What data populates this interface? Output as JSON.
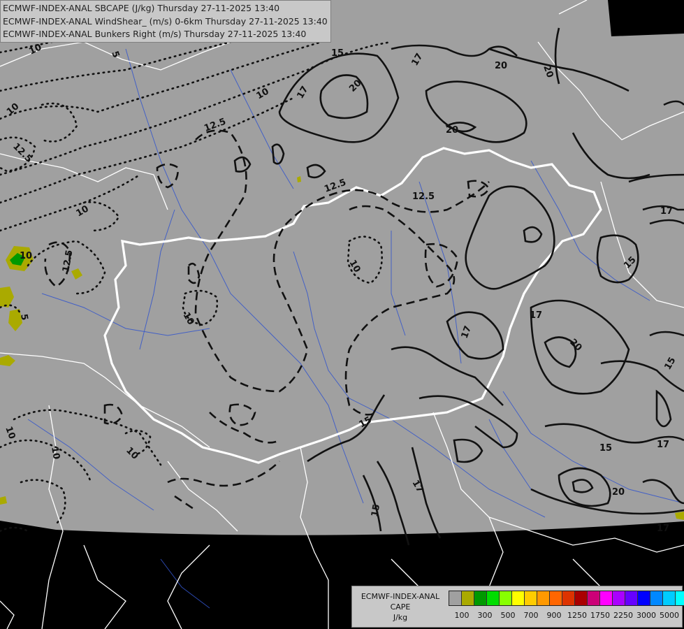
{
  "titles": {
    "line1": "ECMWF-INDEX-ANAL SBCAPE (J/kg) Thursday 27-11-2025 13:40",
    "line2": "ECMWF-INDEX-ANAL WindShear_ (m/s) 0-6km Thursday 27-11-2025 13:40",
    "line3": "ECMWF-INDEX-ANAL Bunkers Right (m/s) Thursday 27-11-2025 13:40"
  },
  "legend": {
    "title_line1": "ECMWF-INDEX-ANAL",
    "title_line2": "CAPE",
    "title_line3": "J/kg",
    "swatch_colors": [
      "#a0a0a0",
      "#aaaa00",
      "#009900",
      "#00dd00",
      "#88ff00",
      "#ffff00",
      "#ffcc00",
      "#ff9900",
      "#ff6600",
      "#dd3300",
      "#aa0000",
      "#cc0077",
      "#ff00ff",
      "#aa00ff",
      "#6600ff",
      "#0000ff",
      "#0088ff",
      "#00ccff",
      "#00ffff",
      "#ffffff"
    ],
    "ticks": [
      "100",
      "300",
      "500",
      "700",
      "900",
      "1250",
      "1750",
      "2250",
      "3000",
      "5000"
    ]
  },
  "contour_labels": {
    "shear_solid": [
      "15",
      "17",
      "20",
      "20",
      "20",
      "17",
      "17",
      "15",
      "17",
      "20",
      "15",
      "17",
      "15",
      "17",
      "20",
      "15",
      "17",
      "15",
      "17",
      "20",
      "15",
      "17"
    ],
    "shear_dashed": [
      "12.5",
      "12.5",
      "12.5",
      "10",
      "10",
      "10"
    ],
    "bunkers_dotted": [
      "10",
      "5",
      "10",
      "12.5",
      "12.5",
      "10",
      "10",
      "5",
      "10",
      "10",
      "10"
    ]
  },
  "colors": {
    "map_fill": "#a0a0a0",
    "outside": "#000000",
    "border": "#ffffff",
    "river": "#3355cc",
    "cape_low": "#aaaa00",
    "cape_mid": "#009900"
  }
}
